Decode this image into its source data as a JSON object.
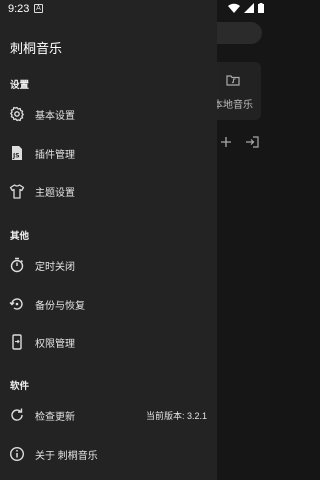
{
  "status_bar": {
    "time": "9:23",
    "notification_badge": "A"
  },
  "background": {
    "card_label": "本地音乐"
  },
  "drawer": {
    "title": "刺桐音乐",
    "sections": [
      {
        "title": "设置",
        "items": [
          {
            "label": "基本设置",
            "icon": "gear-icon"
          },
          {
            "label": "插件管理",
            "icon": "js-file-icon"
          },
          {
            "label": "主题设置",
            "icon": "tshirt-icon"
          }
        ]
      },
      {
        "title": "其他",
        "items": [
          {
            "label": "定时关闭",
            "icon": "timer-icon"
          },
          {
            "label": "备份与恢复",
            "icon": "backup-restore-icon"
          },
          {
            "label": "权限管理",
            "icon": "phone-permission-icon"
          }
        ]
      },
      {
        "title": "软件",
        "items": [
          {
            "label": "检查更新",
            "icon": "refresh-icon",
            "value": "当前版本: 3.2.1"
          },
          {
            "label": "关于 刺桐音乐",
            "icon": "info-icon"
          }
        ]
      }
    ]
  }
}
